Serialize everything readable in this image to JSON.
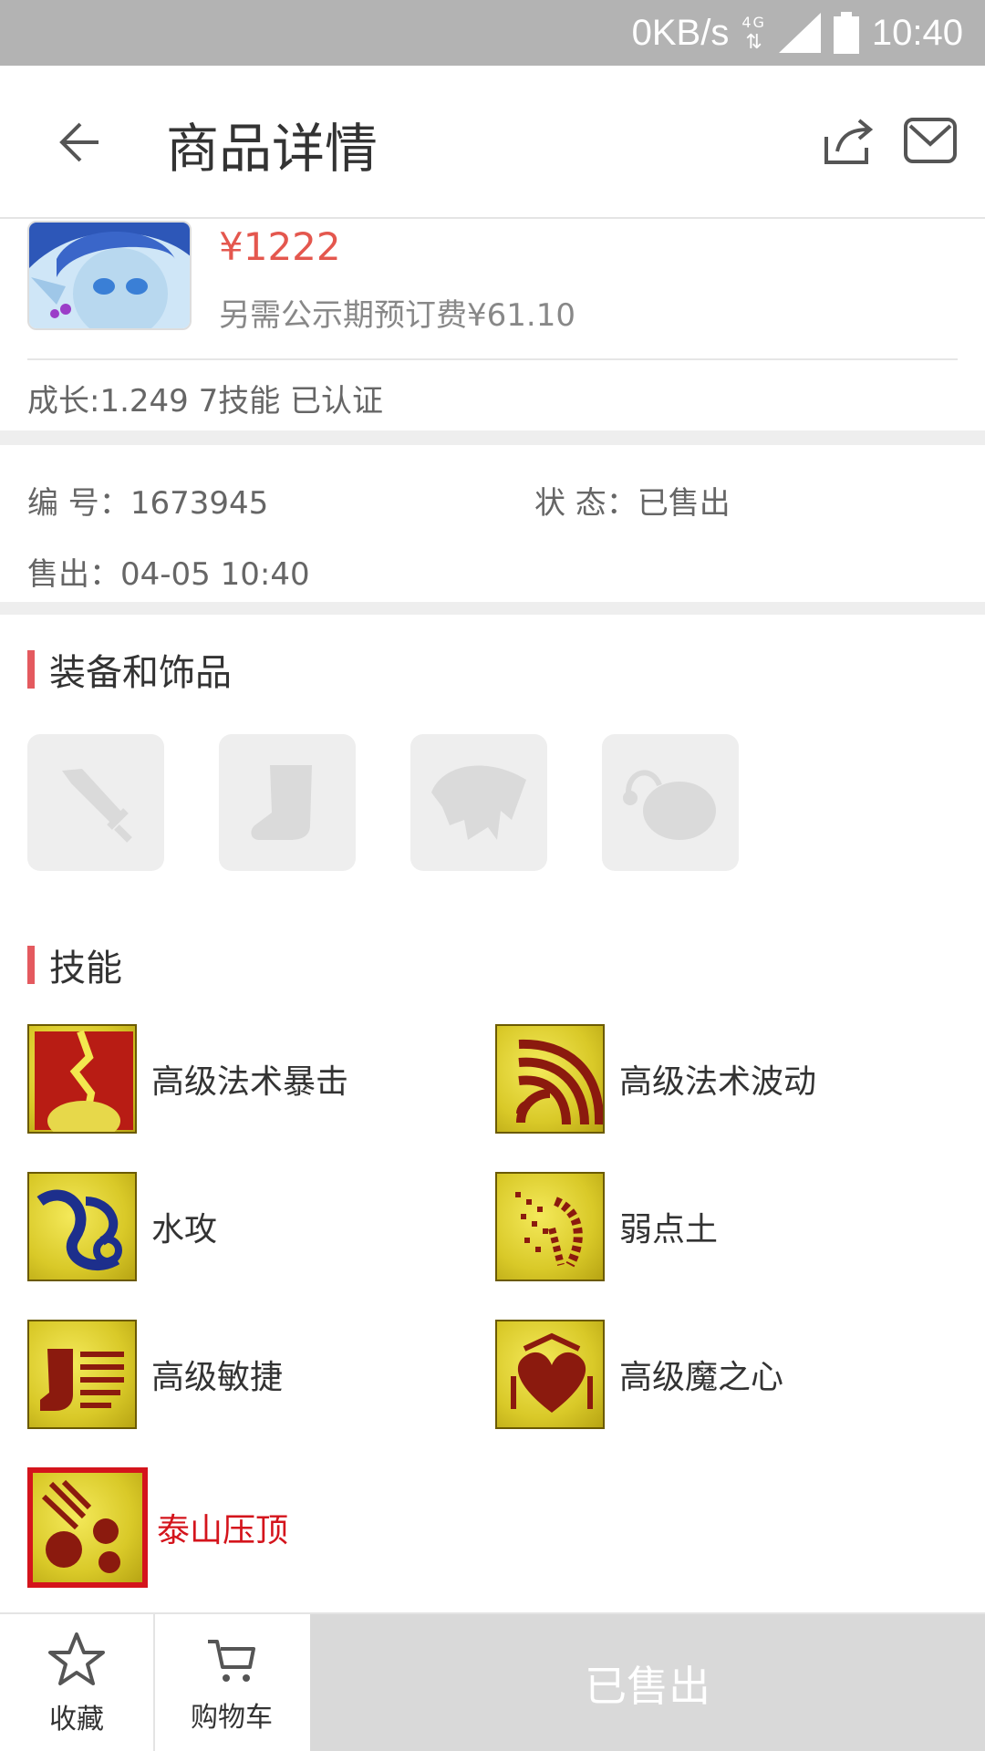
{
  "status_bar": {
    "speed": "0KB/s",
    "network": "4G",
    "time": "10:40"
  },
  "nav": {
    "title": "商品详情"
  },
  "product": {
    "price": "¥1222",
    "fee": "另需公示期预订费¥61.10",
    "growth": "成长:1.249 7技能 已认证"
  },
  "info": {
    "id_label": "编 号：",
    "id_value": "1673945",
    "status_label": "状 态：",
    "status_value": "已售出",
    "sold_label": "售出：",
    "sold_value": "04-05 10:40"
  },
  "equipment": {
    "title": "装备和饰品",
    "slots": [
      "sword-icon",
      "boot-icon",
      "helmet-icon",
      "pouch-icon"
    ]
  },
  "skills": {
    "title": "技能",
    "items": [
      {
        "name": "高级法术暴击",
        "icon": "crack-sun-icon"
      },
      {
        "name": "高级法术波动",
        "icon": "wave-icon"
      },
      {
        "name": "水攻",
        "icon": "water-icon"
      },
      {
        "name": "弱点土",
        "icon": "earth-weak-icon"
      },
      {
        "name": "高级敏捷",
        "icon": "boot-speed-icon"
      },
      {
        "name": "高级魔之心",
        "icon": "demon-heart-icon"
      },
      {
        "name": "泰山压顶",
        "icon": "boulder-icon",
        "highlight": "#d4141c"
      }
    ]
  },
  "bottom": {
    "favorite": "收藏",
    "cart": "购物车",
    "sold": "已售出"
  }
}
